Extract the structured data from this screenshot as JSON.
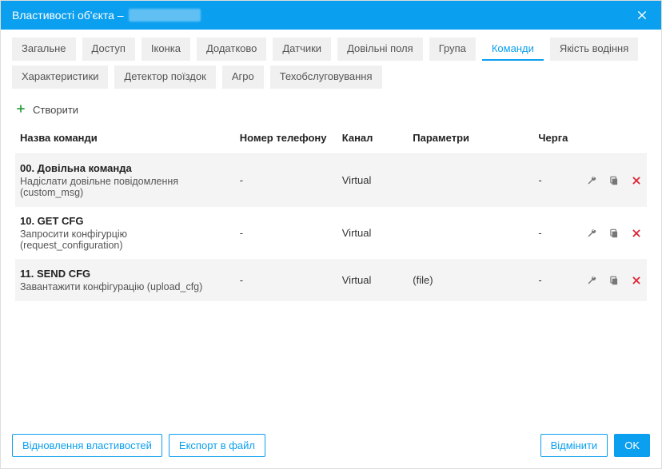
{
  "title_prefix": "Властивості об'єкта –",
  "tabs": {
    "row1": [
      "Загальне",
      "Доступ",
      "Іконка",
      "Додатково",
      "Датчики",
      "Довільні поля",
      "Група",
      "Команди",
      "Якість водіння"
    ],
    "row2": [
      "Характеристики",
      "Детектор поїздок",
      "Агро",
      "Техобслуговування"
    ],
    "active": "Команди"
  },
  "create_label": "Створити",
  "columns": {
    "name": "Назва команди",
    "phone": "Номер телефону",
    "channel": "Канал",
    "params": "Параметри",
    "queue": "Черга"
  },
  "rows": [
    {
      "name": "00. Довільна команда",
      "sub": "Надіслати довільне повідомлення (custom_msg)",
      "phone": "-",
      "channel": "Virtual",
      "params": "",
      "queue": "-"
    },
    {
      "name": "10. GET CFG",
      "sub": "Запросити конфігурцію (request_configuration)",
      "phone": "-",
      "channel": "Virtual",
      "params": "",
      "queue": "-"
    },
    {
      "name": "11. SEND CFG",
      "sub": "Завантажити конфігурацію (upload_cfg)",
      "phone": "-",
      "channel": "Virtual",
      "params": "(file)",
      "queue": "-"
    }
  ],
  "footer": {
    "restore": "Відновлення властивостей",
    "export": "Експорт в файл",
    "cancel": "Відмінити",
    "ok": "OK"
  },
  "icons": {
    "wrench": "settings-icon",
    "copy": "copy-icon",
    "delete": "delete-icon"
  }
}
